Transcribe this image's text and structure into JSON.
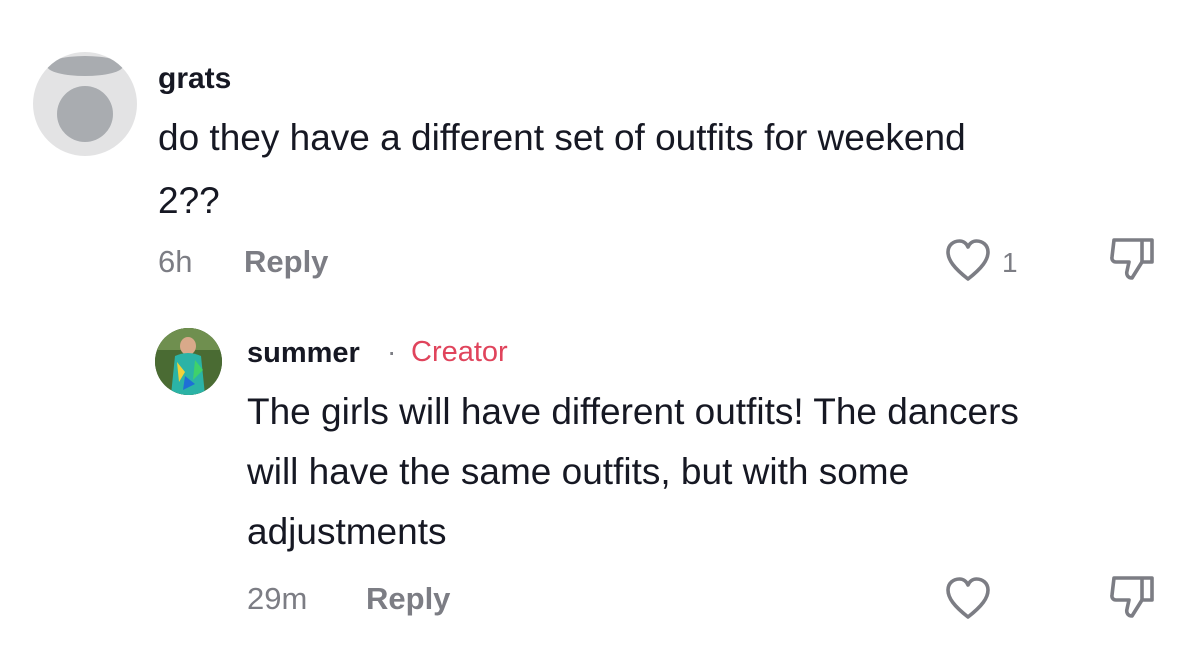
{
  "comments": [
    {
      "username": "grats",
      "text_lines": [
        "do they have a different set of outfits for weekend",
        "2??"
      ],
      "time": "6h",
      "reply_label": "Reply",
      "like_count": "1",
      "avatar": "default-avatar-icon"
    },
    {
      "username": "summer",
      "separator": "·",
      "creator_label": "Creator",
      "text_lines": [
        "The girls will have different outfits! The dancers",
        "will have the same outfits, but with some",
        "adjustments"
      ],
      "time": "29m",
      "reply_label": "Reply",
      "avatar": "user-photo"
    }
  ],
  "colors": {
    "text": "#161823",
    "secondary": "#7c7d84",
    "creator": "#e0445c",
    "avatar_bg": "#e3e3e4"
  }
}
